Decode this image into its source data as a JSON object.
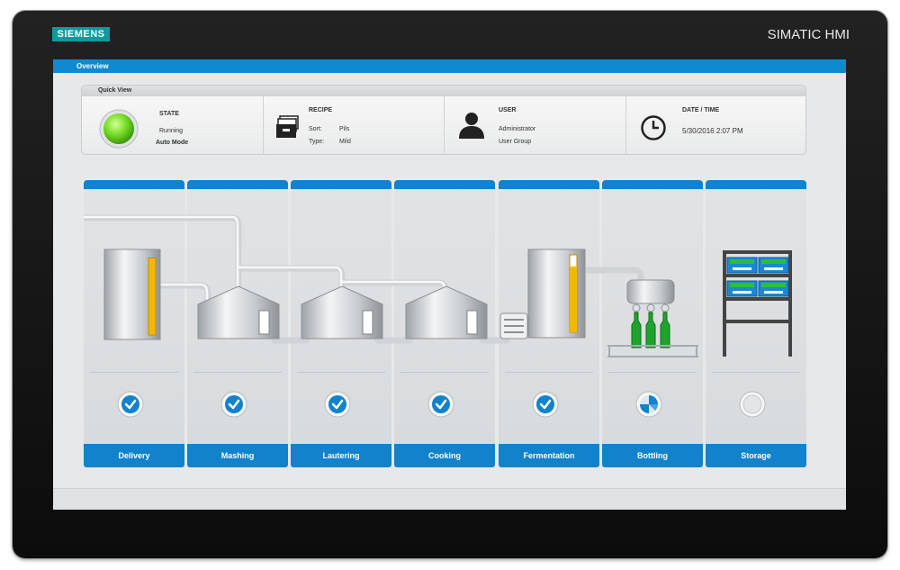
{
  "device": {
    "brand": "SIEMENS",
    "model": "SIMATIC HMI"
  },
  "screen": {
    "title": "Overview"
  },
  "quick_view": {
    "title": "Quick View",
    "state": {
      "heading": "STATE",
      "status": "Running",
      "mode": "Auto Mode"
    },
    "recipe": {
      "heading": "RECIPE",
      "sort_label": "Sort:",
      "sort_value": "Pils",
      "type_label": "Type:",
      "type_value": "Mild"
    },
    "user": {
      "heading": "USER",
      "name": "Administrator",
      "group": "User Group"
    },
    "datetime": {
      "heading": "DATE / TIME",
      "value": "5/30/2016 2:07 PM"
    }
  },
  "stations": [
    {
      "label": "Delivery",
      "status": "done",
      "level": 0.95
    },
    {
      "label": "Mashing",
      "status": "done"
    },
    {
      "label": "Lautering",
      "status": "done"
    },
    {
      "label": "Cooking",
      "status": "done"
    },
    {
      "label": "Fermentation",
      "status": "done",
      "level": 0.85
    },
    {
      "label": "Bottling",
      "status": "in-progress"
    },
    {
      "label": "Storage",
      "status": "idle"
    }
  ],
  "colors": {
    "accent": "#1282cc",
    "running": "#7be02a",
    "level": "#f5b800",
    "brand": "#0a9b9e",
    "bottle": "#1fa32c"
  }
}
